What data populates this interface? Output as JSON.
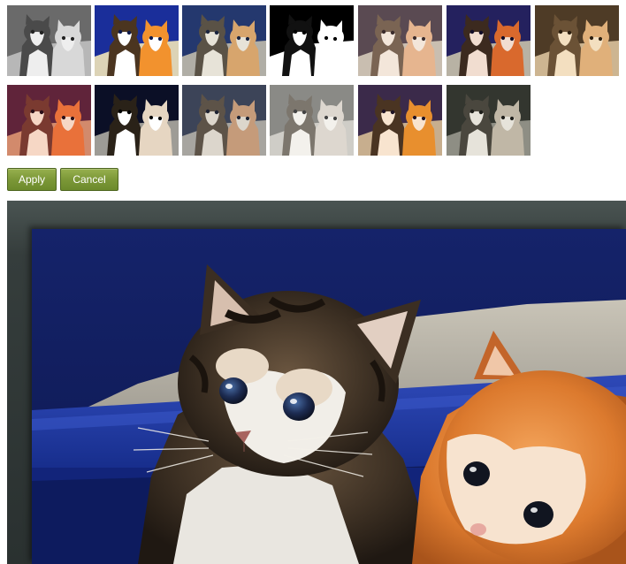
{
  "filters": {
    "thumbnails": [
      {
        "id": "grayscale"
      },
      {
        "id": "vivid"
      },
      {
        "id": "cool"
      },
      {
        "id": "threshold"
      },
      {
        "id": "faded"
      },
      {
        "id": "contrast"
      },
      {
        "id": "sepia"
      },
      {
        "id": "warm-red"
      },
      {
        "id": "high-contrast"
      },
      {
        "id": "muted"
      },
      {
        "id": "washed-out"
      },
      {
        "id": "saturated-warm"
      },
      {
        "id": "desaturated"
      }
    ]
  },
  "actions": {
    "apply_label": "Apply",
    "cancel_label": "Cancel"
  },
  "colors": {
    "button_green": "#7c9838",
    "frame_dark": "#2a3130",
    "litter_box_blue": "#1a2f80"
  }
}
